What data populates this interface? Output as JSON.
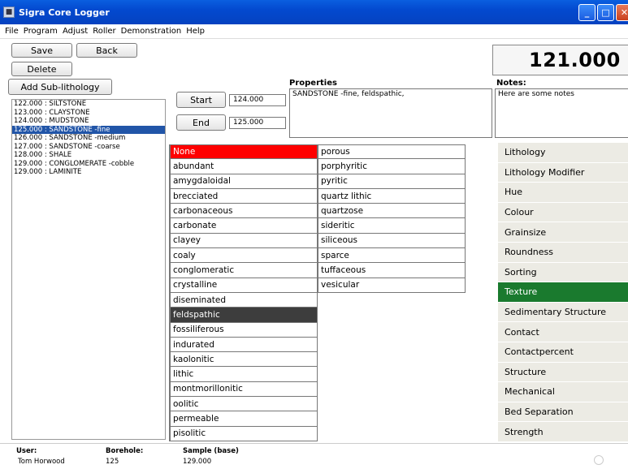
{
  "window": {
    "title": "Sigra Core Logger"
  },
  "menu": [
    "File",
    "Program",
    "Adjust",
    "Roller",
    "Demonstration",
    "Help"
  ],
  "toolbar": {
    "save": "Save",
    "back": "Back",
    "delete": "Delete",
    "add_sub": "Add Sub-lithology"
  },
  "depth_display": "121.000",
  "intervals": [
    "122.000 : SILTSTONE",
    "123.000 : CLAYSTONE",
    "124.000 : MUDSTONE",
    "125.000 : SANDSTONE -fine",
    "126.000 : SANDSTONE -medium",
    "127.000 : SANDSTONE -coarse",
    "128.000 : SHALE",
    "129.000 : CONGLOMERATE -cobble",
    "129.000 : LAMINITE"
  ],
  "selected_interval_index": 3,
  "start": {
    "label": "Start",
    "value": "124.000"
  },
  "end": {
    "label": "End",
    "value": "125.000"
  },
  "properties": {
    "label": "Properties",
    "value": "SANDSTONE -fine, feldspathic,"
  },
  "notes": {
    "label": "Notes:",
    "value": "Here are some notes"
  },
  "terms_col1": [
    "None",
    "abundant",
    "amygdaloidal",
    "brecciated",
    "carbonaceous",
    "carbonate",
    "clayey",
    "coaly",
    "conglomeratic",
    "crystalline",
    "diseminated",
    "feldspathic",
    "fossiliferous",
    "indurated",
    "kaolonitic",
    "lithic",
    "montmorillonitic",
    "oolitic",
    "permeable",
    "pisolitic"
  ],
  "terms_col2": [
    "porous",
    "porphyritic",
    "pyritic",
    "quartz lithic",
    "quartzose",
    "sideritic",
    "siliceous",
    "sparce",
    "tuffaceous",
    "vesicular"
  ],
  "categories": [
    "Lithology",
    "Lithology Modifier",
    "Hue",
    "Colour",
    "Grainsize",
    "Roundness",
    "Sorting",
    "Texture",
    "Sedimentary Structure",
    "Contact",
    "Contactpercent",
    "Structure",
    "Mechanical",
    "Bed Separation",
    "Strength"
  ],
  "active_category_index": 7,
  "status": {
    "user_label": "User:",
    "user_value": "Tom Horwood",
    "borehole_label": "Borehole:",
    "borehole_value": "125",
    "sample_label": "Sample (base)",
    "sample_value": "129.000"
  },
  "colors": {
    "accent_red": "#ff0000",
    "selected_dark": "#3d3d3d",
    "active_green": "#1a7a2e",
    "list_selected": "#2155a8"
  }
}
